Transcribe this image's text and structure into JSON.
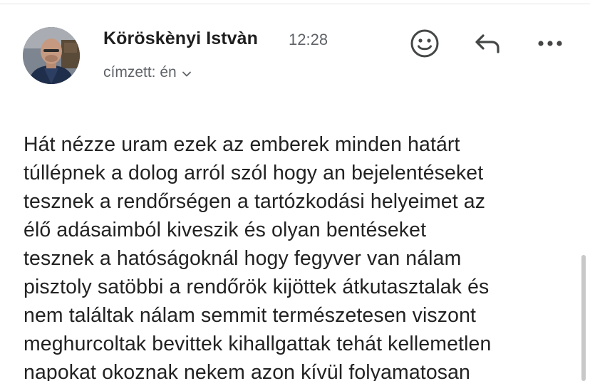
{
  "email": {
    "sender_name": "Köröskènyi Istvàn",
    "time": "12:28",
    "recipient_label": "címzett: én",
    "body_lines": [
      "Hát nézze uram ezek az emberek minden határt",
      "túllépnek a dolog arról szól hogy an bejelentéseket",
      "tesznek a rendőrségen a tartózkodási helyeimet az",
      "élő adásaimból kiveszik és olyan bentéseket",
      "tesznek a hatóságoknál hogy fegyver van nálam",
      "pisztoly satöbbi a rendőrök kijöttek átkutasztalak és",
      "nem találtak nálam semmit természetesen viszont",
      "meghurcoltak bevittek kihallgattak tehát kellemetlen",
      "napokat okoznak nekem azon kívül folyamatosan"
    ]
  },
  "icons": {
    "avatar": "avatar-photo",
    "emoji": "smiley-face-icon",
    "reply": "reply-arrow-icon",
    "more": "more-dots-icon",
    "chevron": "chevron-down-icon"
  },
  "colors": {
    "text_primary": "#1f1f1f",
    "text_secondary": "#5f6368",
    "icon": "#444746",
    "background": "#ffffff"
  }
}
